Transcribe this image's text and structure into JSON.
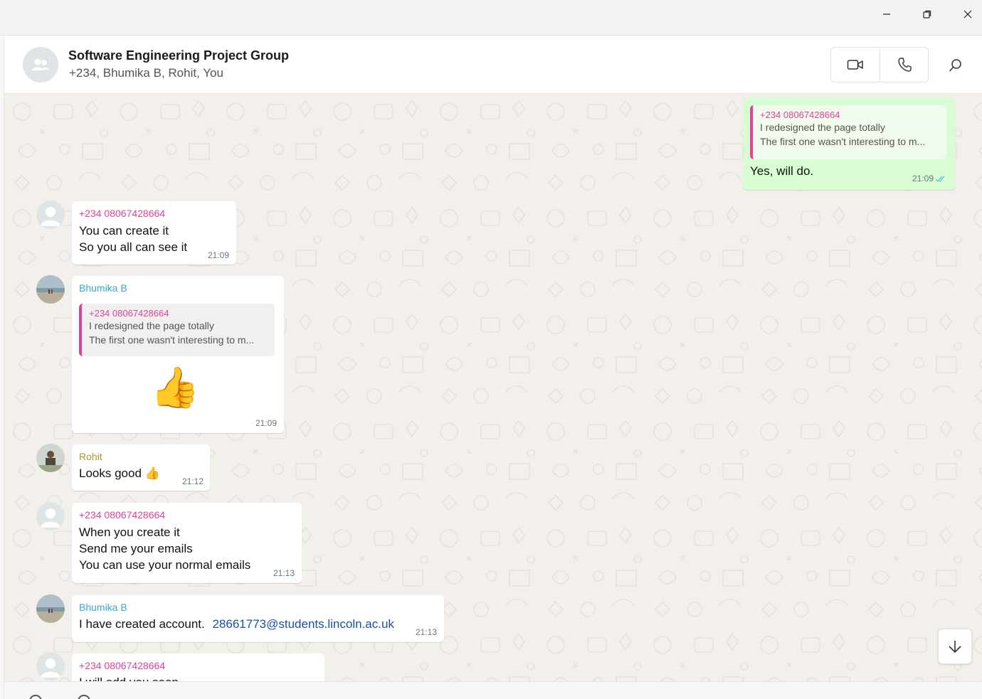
{
  "header": {
    "title": "Software Engineering Project Group",
    "participants": "+234, Bhumika B, Rohit, You"
  },
  "colors": {
    "chat_background": "#f3f0ec",
    "outgoing_bubble": "#d9fdd3",
    "incoming_bubble": "#ffffff",
    "sender_phone": "#e0429a",
    "sender_bhumika": "#35a8c9",
    "sender_rohit": "#9c9c2a",
    "read_ticks": "#53bdeb",
    "link": "#1a4fa3"
  },
  "icons": {
    "window": [
      "minimize-icon",
      "restore-icon",
      "close-icon"
    ],
    "header": [
      "group-avatar-icon",
      "video-call-icon",
      "voice-call-icon",
      "search-icon"
    ],
    "chat": [
      "scroll-down-arrow-icon",
      "thumbs-up-emoji",
      "read-receipt-icon"
    ]
  },
  "messages": {
    "m1": {
      "direction": "out",
      "quote_sender": "+234 08067428664",
      "quote_line1": "I redesigned the page totally",
      "quote_line2": "The first one wasn't interesting to m...",
      "text": "Yes, will do.",
      "time": "21:09"
    },
    "m2": {
      "sender": "+234 08067428664",
      "line1": "You can create it",
      "line2": "So you all can see it",
      "time": "21:09"
    },
    "m3": {
      "sender": "Bhumika B",
      "quote_sender": "+234 08067428664",
      "quote_line1": "I redesigned the page totally",
      "quote_line2": "The first one wasn't interesting to m...",
      "sticker": "👍",
      "time": "21:09"
    },
    "m4": {
      "sender": "Rohit",
      "text": "Looks good",
      "emoji": "👍",
      "time": "21:12"
    },
    "m5": {
      "sender": "+234 08067428664",
      "line1": "When you create it",
      "line2": "Send me your emails",
      "line3": "You can use your normal emails",
      "time": "21:13"
    },
    "m6": {
      "sender": "Bhumika B",
      "text": "I have created account.",
      "link": "28661773@students.lincoln.ac.uk",
      "time": "21:13"
    },
    "m7": {
      "sender": "+234 08067428664",
      "partial_line": "I will add you soon"
    }
  }
}
